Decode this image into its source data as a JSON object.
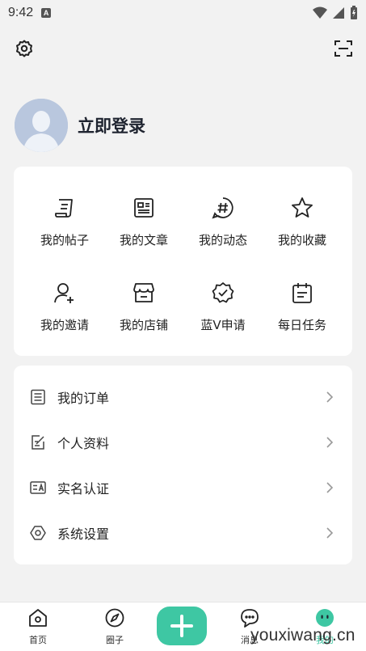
{
  "status_bar": {
    "time": "9:42",
    "badge": "A"
  },
  "profile": {
    "login_label": "立即登录"
  },
  "grid": [
    {
      "label": "我的帖子",
      "icon": "post-icon"
    },
    {
      "label": "我的文章",
      "icon": "article-icon"
    },
    {
      "label": "我的动态",
      "icon": "hashtag-icon"
    },
    {
      "label": "我的收藏",
      "icon": "star-icon"
    },
    {
      "label": "我的邀请",
      "icon": "invite-user-icon"
    },
    {
      "label": "我的店铺",
      "icon": "store-icon"
    },
    {
      "label": "蓝V申请",
      "icon": "verified-badge-icon"
    },
    {
      "label": "每日任务",
      "icon": "calendar-icon"
    }
  ],
  "list": [
    {
      "label": "我的订单",
      "icon": "order-list-icon"
    },
    {
      "label": "个人资料",
      "icon": "edit-profile-icon"
    },
    {
      "label": "实名认证",
      "icon": "id-card-icon"
    },
    {
      "label": "系统设置",
      "icon": "hexagon-settings-icon"
    }
  ],
  "bottom_nav": [
    {
      "label": "首页",
      "icon": "home-icon"
    },
    {
      "label": "圈子",
      "icon": "compass-icon"
    },
    {
      "label": "消息",
      "icon": "message-icon"
    },
    {
      "label": "我的",
      "icon": "profile-face-icon"
    }
  ],
  "watermark": "youxiwang.cn",
  "colors": {
    "accent": "#3ec7a3",
    "background": "#f2f2f2",
    "card": "#ffffff"
  }
}
